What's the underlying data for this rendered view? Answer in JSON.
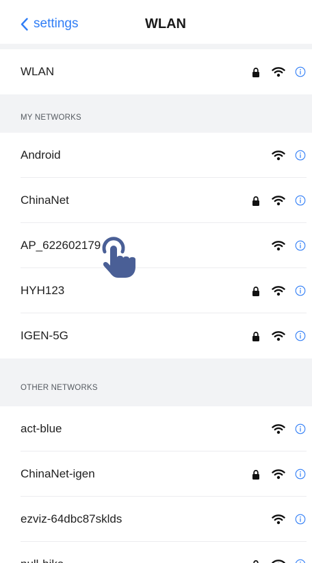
{
  "navbar": {
    "back_label": "settings",
    "title": "WLAN"
  },
  "wlan_row": {
    "label": "WLAN",
    "locked": true
  },
  "my_networks": {
    "header": "MY NETWORKS",
    "items": [
      {
        "name": "Android",
        "locked": false
      },
      {
        "name": "ChinaNet",
        "locked": true
      },
      {
        "name": "AP_622602179",
        "locked": false
      },
      {
        "name": "HYH123",
        "locked": true
      },
      {
        "name": "IGEN-5G",
        "locked": true
      }
    ]
  },
  "other_networks": {
    "header": "OTHER  NETWORKS",
    "items": [
      {
        "name": "act-blue",
        "locked": false
      },
      {
        "name": "ChinaNet-igen",
        "locked": true
      },
      {
        "name": "ezviz-64dbc87sklds",
        "locked": false
      },
      {
        "name": "null-hika",
        "locked": true
      }
    ]
  },
  "icons": {
    "back": "chevron-left-icon",
    "lock": "lock-icon",
    "wifi": "wifi-icon",
    "info": "info-icon",
    "pointer": "tap-hand-icon"
  },
  "colors": {
    "accent": "#2f7df6",
    "section_bg": "#f2f3f5",
    "text": "#1f1f1f",
    "hand": "#4a5f96"
  }
}
